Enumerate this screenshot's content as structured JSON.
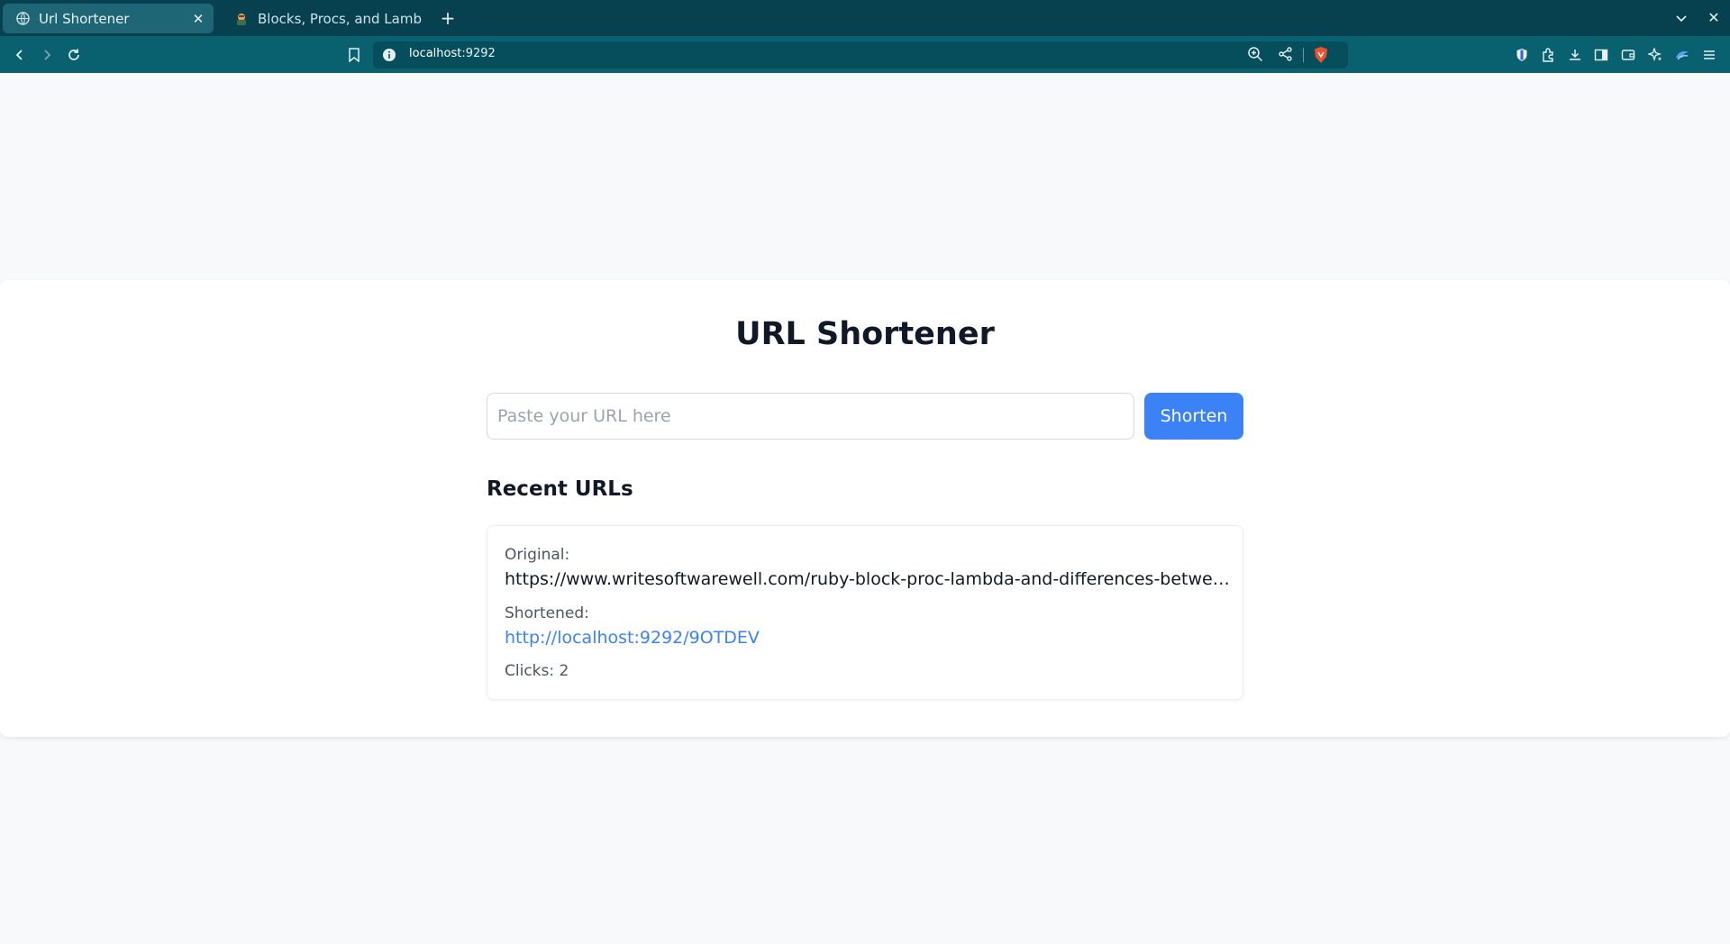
{
  "browser": {
    "tabs": [
      {
        "title": "Url Shortener",
        "active": true
      },
      {
        "title": "Blocks, Procs, and Lambdas:",
        "active": false
      }
    ],
    "address": {
      "host": "localhost",
      "port": ":9292"
    }
  },
  "page": {
    "title": "URL Shortener",
    "input_placeholder": "Paste your URL here",
    "shorten_label": "Shorten",
    "recent_title": "Recent URLs",
    "items": [
      {
        "original_label": "Original:",
        "original_url": "https://www.writesoftwarewell.com/ruby-block-proc-lambda-and-differences-betwee...",
        "shortened_label": "Shortened:",
        "short_url": "http://localhost:9292/9OTDEV",
        "clicks": "Clicks: 2"
      }
    ]
  },
  "colors": {
    "tabstrip": "#07414f",
    "toolbar": "#096170",
    "accent": "#3b82f6",
    "page_bg": "#f8f9fb"
  }
}
